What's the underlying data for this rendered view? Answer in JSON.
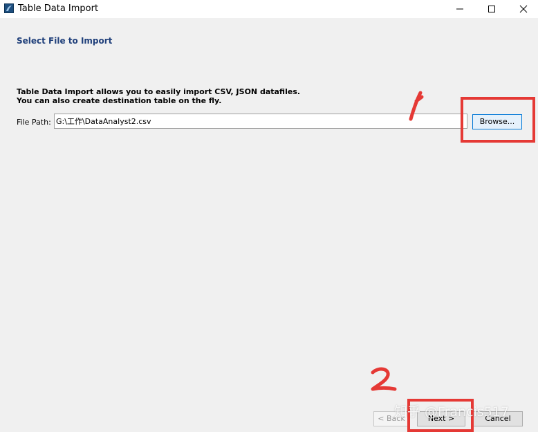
{
  "window": {
    "title": "Table Data Import",
    "icon": "mysql-workbench-icon",
    "controls": [
      "minimize-icon",
      "maximize-icon",
      "close-icon"
    ]
  },
  "page": {
    "heading": "Select File to Import",
    "description_line1": "Table Data Import allows you to easily import CSV, JSON datafiles.",
    "description_line2": "You can also create destination table on the fly."
  },
  "file_path": {
    "label": "File Path:",
    "value": "G:\\工作\\DataAnalyst2.csv",
    "browse_label": "Browse..."
  },
  "footer": {
    "back_label": "< Back",
    "next_label": "Next >",
    "cancel_label": "Cancel"
  },
  "annotations": {
    "step1": "1",
    "step2": "2",
    "color": "#e53935"
  },
  "watermark": "知乎 @Francis517"
}
